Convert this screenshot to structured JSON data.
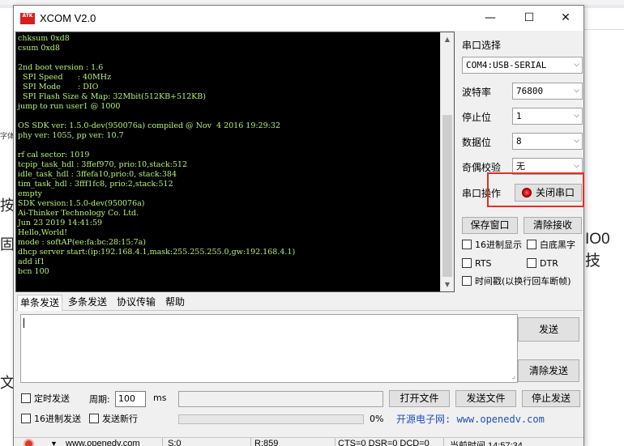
{
  "background": {
    "fragments": [
      "按",
      "固",
      "文",
      "字体",
      "IO0技"
    ]
  },
  "window": {
    "logo": "ATK",
    "title": "XCOM V2.0",
    "controls": {
      "minimize": "—",
      "maximize": "☐",
      "close": "✕"
    }
  },
  "terminal": {
    "lines": [
      "chksum 0xd8",
      "csum 0xd8",
      "",
      "2nd boot version : 1.6",
      "  SPI Speed      : 40MHz",
      "  SPI Mode       : DIO",
      "  SPI Flash Size & Map: 32Mbit(512KB+512KB)",
      "jump to run user1 @ 1000",
      "",
      "OS SDK ver: 1.5.0-dev(950076a) compiled @ Nov  4 2016 19:29:32",
      "phy ver: 1055, pp ver: 10.7",
      "",
      "rf cal sector: 1019",
      "tcpip_task_hdl : 3ffef970, prio:10,stack:512",
      "idle_task_hdl : 3ffefa10,prio:0, stack:384",
      "tim_task_hdl : 3fff1fc8, prio:2,stack:512",
      "empty",
      "SDK version:1.5.0-dev(950076a)",
      "Ai-Thinker Technology Co. Ltd.",
      "Jun 23 2019 14:41:59",
      "Hello,World!",
      "mode : softAP(ee:fa:bc:28:15:7a)",
      "dhcp server start:(ip:192.168.4.1,mask:255.255.255.0,gw:192.168.4.1)",
      "add if1",
      "bcn 100"
    ]
  },
  "settings": {
    "port_label": "串口选择",
    "port_value": "COM4:USB-SERIAL",
    "baud_label": "波特率",
    "baud_value": "76800",
    "stopbits_label": "停止位",
    "stopbits_value": "1",
    "databits_label": "数据位",
    "databits_value": "8",
    "parity_label": "奇偶校验",
    "parity_value": "无",
    "operate_label": "串口操作",
    "close_port_label": "关闭串口",
    "save_window_label": "保存窗口",
    "clear_receive_label": "清除接收",
    "hex_display_label": "16进制显示",
    "white_black_label": "白底黑字",
    "rts_label": "RTS",
    "dtr_label": "DTR",
    "timestamp_label": "时间戳(以换行回车断帧)"
  },
  "tabs": [
    "单条发送",
    "多条发送",
    "协议传输",
    "帮助"
  ],
  "send": {
    "input_value": "",
    "send_label": "发送",
    "clear_send_label": "清除发送",
    "timed_send_label": "定时发送",
    "period_label": "周期:",
    "period_value": "100",
    "period_unit": "ms",
    "hex_send_label": "16进制发送",
    "send_newline_label": "发送新行",
    "open_file_label": "打开文件",
    "send_file_label": "发送文件",
    "stop_send_label": "停止发送",
    "progress_text": "0%",
    "progress_value": 0,
    "website": "开源电子网: www.openedv.com"
  },
  "status": {
    "url": "www.openedv.com",
    "sent": "S:0",
    "received": "R:859",
    "signals": "CTS=0 DSR=0 DCD=0",
    "time": "当前时间 14:57:34"
  },
  "colors": {
    "terminal_bg": "#000000",
    "terminal_text": "#b7f07a",
    "highlight_frame": "#e0302a",
    "link": "#1e4fb8"
  }
}
